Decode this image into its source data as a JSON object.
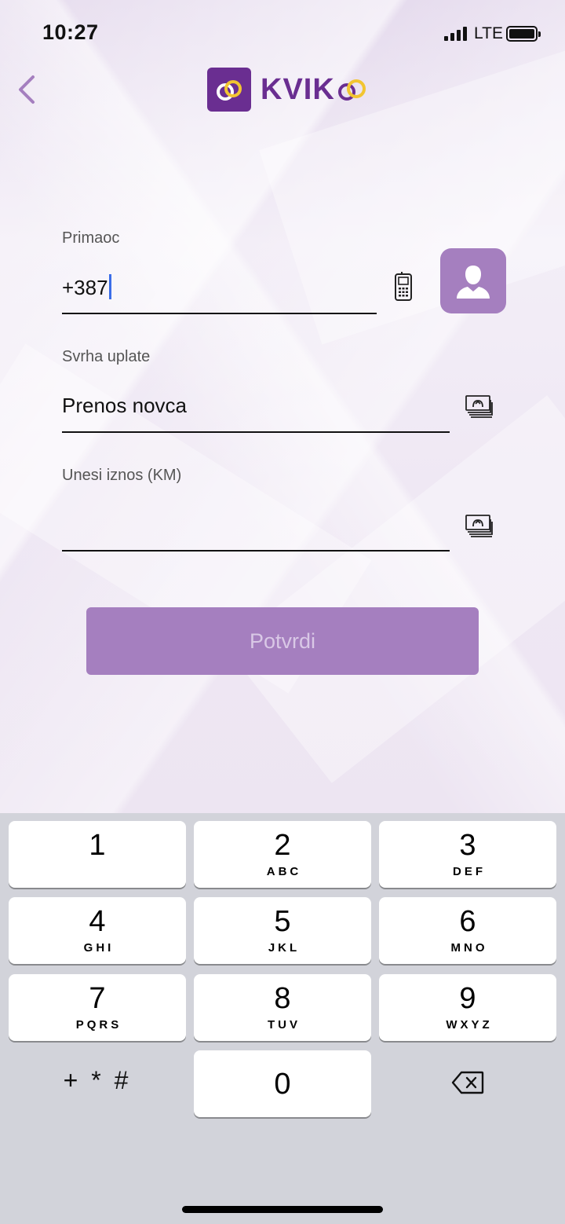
{
  "status_bar": {
    "time": "10:27",
    "carrier": "LTE"
  },
  "header": {
    "logo_text": "KVIK"
  },
  "form": {
    "recipient": {
      "label": "Primaoc",
      "value": "+387"
    },
    "purpose": {
      "label": "Svrha uplate",
      "value": "Prenos novca"
    },
    "amount": {
      "label": "Unesi iznos (KM)",
      "value": ""
    },
    "confirm_label": "Potvrdi"
  },
  "keyboard": {
    "keys": [
      {
        "num": "1",
        "letters": ""
      },
      {
        "num": "2",
        "letters": "ABC"
      },
      {
        "num": "3",
        "letters": "DEF"
      },
      {
        "num": "4",
        "letters": "GHI"
      },
      {
        "num": "5",
        "letters": "JKL"
      },
      {
        "num": "6",
        "letters": "MNO"
      },
      {
        "num": "7",
        "letters": "PQRS"
      },
      {
        "num": "8",
        "letters": "TUV"
      },
      {
        "num": "9",
        "letters": "WXYZ"
      }
    ],
    "symbols": "+ * #",
    "zero": "0"
  },
  "colors": {
    "brand": "#6a2e91",
    "accent": "#a57fbf",
    "logo_ring": "#f2c531"
  }
}
